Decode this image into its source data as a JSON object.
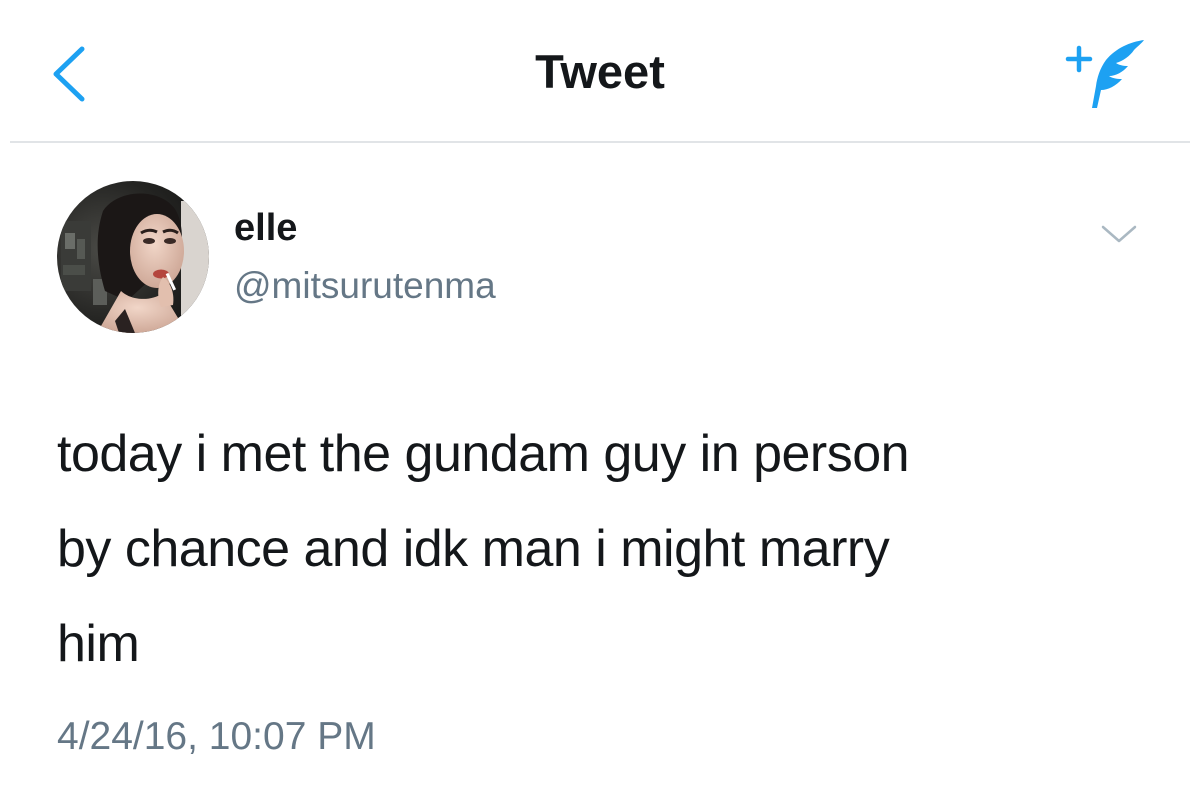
{
  "nav": {
    "back_icon": "chevron-left-icon",
    "title": "Tweet",
    "compose_icon": "compose-tweet-icon",
    "accent_color": "#1da1f2"
  },
  "tweet": {
    "author": {
      "display_name": "elle",
      "handle": "@mitsurutenma",
      "avatar": "profile-photo"
    },
    "menu_icon": "chevron-down-icon",
    "text_lines": [
      "today i met the gundam guy in person",
      "by chance and idk man i might marry",
      "him"
    ],
    "timestamp": "4/24/16, 10:07 PM"
  }
}
